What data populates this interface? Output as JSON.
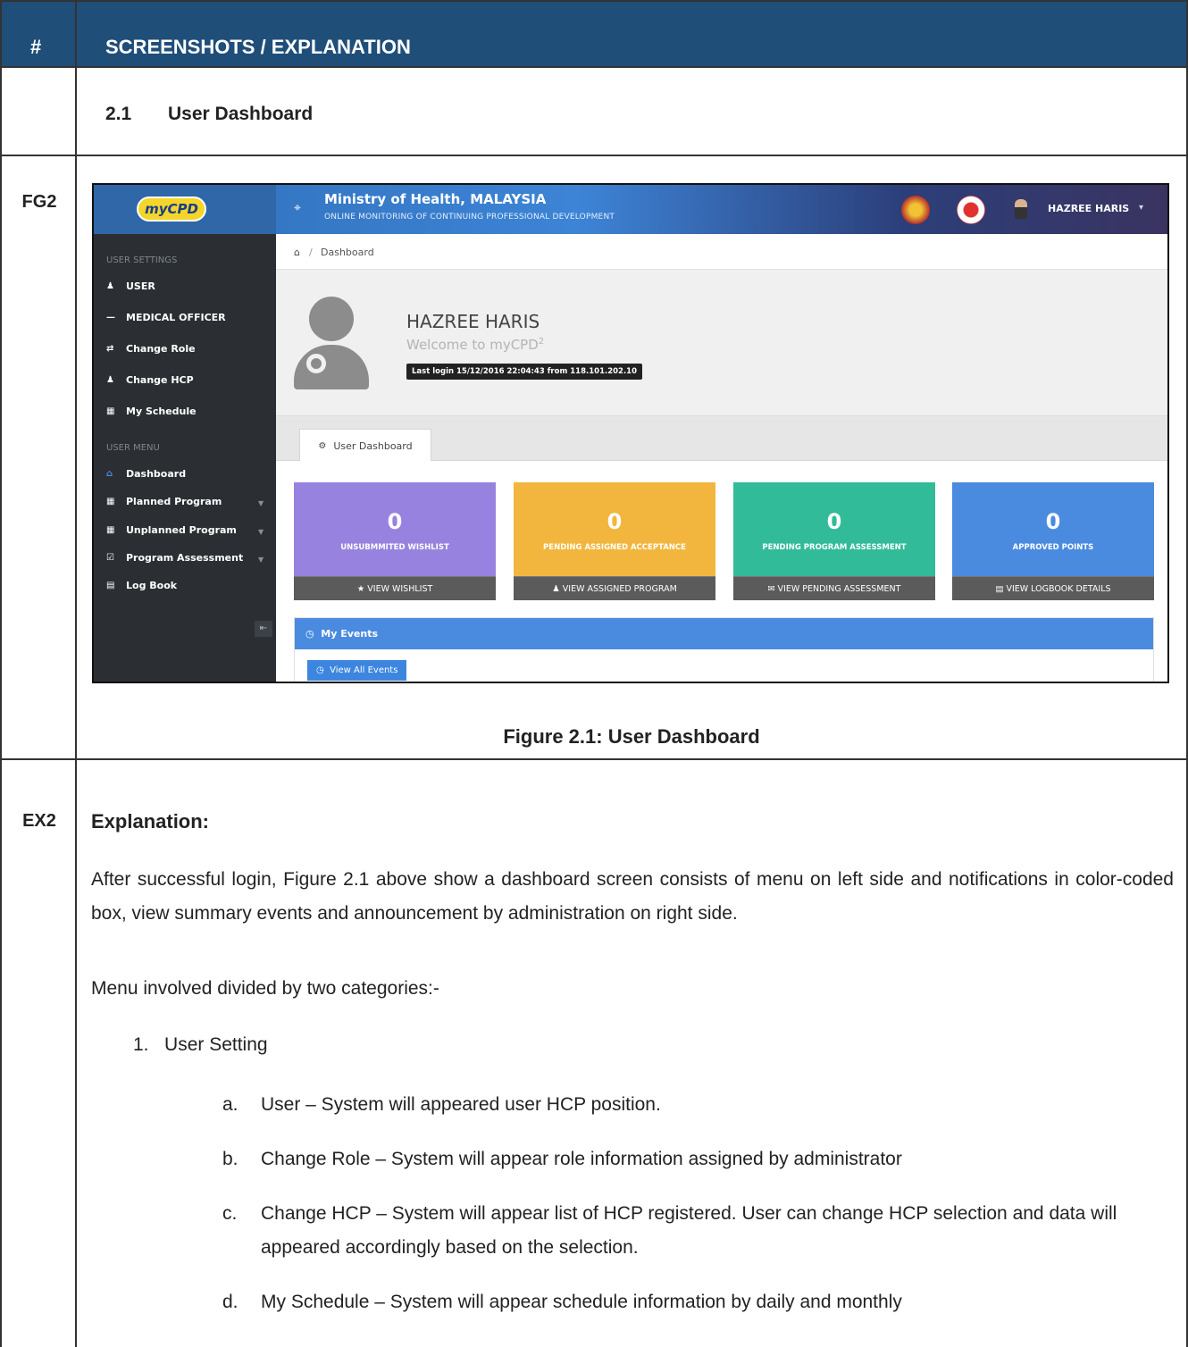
{
  "table": {
    "hash": "#",
    "header": "SCREENSHOTS / EXPLANATION",
    "section_num": "2.1",
    "section_title": "User Dashboard",
    "fig_label": "FG2",
    "ex_label": "EX2",
    "caption": "Figure 2.1: User Dashboard"
  },
  "app": {
    "logo": "myCPD",
    "title": "Ministry of Health, MALAYSIA",
    "subtitle": "ONLINE MONITORING OF CONTINUING PROFESSIONAL DEVELOPMENT",
    "user": "HAZREE HARIS"
  },
  "sidebar": {
    "settings_label": "USER SETTINGS",
    "settings_items": [
      {
        "label": "USER",
        "icon": "user-icon"
      },
      {
        "label": "MEDICAL OFFICER",
        "icon": "dash-icon"
      },
      {
        "label": "Change Role",
        "icon": "exchange-icon"
      },
      {
        "label": "Change HCP",
        "icon": "users-icon"
      },
      {
        "label": "My Schedule",
        "icon": "calendar-icon"
      }
    ],
    "menu_label": "USER MENU",
    "menu_items": [
      {
        "label": "Dashboard",
        "icon": "home-icon"
      },
      {
        "label": "Planned Program",
        "icon": "calendar-icon"
      },
      {
        "label": "Unplanned Program",
        "icon": "calendar-icon"
      },
      {
        "label": "Program Assessment",
        "icon": "check-square-icon"
      },
      {
        "label": "Log Book",
        "icon": "book-icon"
      }
    ]
  },
  "breadcrumb": {
    "current": "Dashboard"
  },
  "profile": {
    "name": "HAZREE HARIS",
    "welcome": "Welcome to myCPD",
    "welcome_sup": "2",
    "last_login": "Last login 15/12/2016 22:04:43 from 118.101.202.10"
  },
  "tab": {
    "label": "User Dashboard"
  },
  "stats": [
    {
      "value": "0",
      "label": "UNSUBMMITED WISHLIST",
      "action": "VIEW WISHLIST",
      "color": "#9783df"
    },
    {
      "value": "0",
      "label": "PENDING ASSIGNED ACCEPTANCE",
      "action": "VIEW ASSIGNED PROGRAM",
      "color": "#f2b63e"
    },
    {
      "value": "0",
      "label": "PENDING PROGRAM ASSESSMENT",
      "action": "VIEW PENDING ASSESSMENT",
      "color": "#32bb99"
    },
    {
      "value": "0",
      "label": "APPROVED POINTS",
      "action": "VIEW LOGBOOK DETAILS",
      "color": "#4a8be0"
    }
  ],
  "events": {
    "title": "My Events",
    "button": "View All Events"
  },
  "explanation": {
    "title": "Explanation:",
    "paragraph": "After successful login, Figure 2.1 above show a dashboard screen consists of menu on left side and notifications in color-coded box, view summary events and announcement by administration on right side.",
    "menu_intro": "Menu involved divided by two categories:-",
    "list1_num": "1.",
    "list1_title": "User Setting",
    "sub_items": [
      {
        "mark": "a.",
        "text": "User – System will appeared user HCP position."
      },
      {
        "mark": "b.",
        "text": "Change Role –  System will appear role information assigned by administrator"
      },
      {
        "mark": "c.",
        "text": "Change HCP – System will appear list of HCP registered. User can change HCP selection and data will appeared accordingly based on the selection."
      },
      {
        "mark": "d.",
        "text": "My Schedule – System will appear schedule information by daily and monthly"
      }
    ]
  }
}
